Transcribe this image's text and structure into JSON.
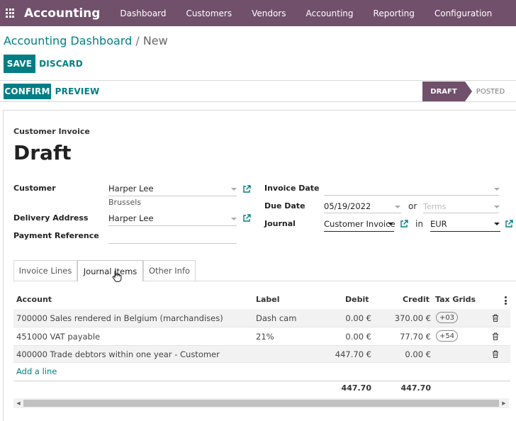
{
  "navbar": {
    "brand": "Accounting",
    "menu": [
      "Dashboard",
      "Customers",
      "Vendors",
      "Accounting",
      "Reporting",
      "Configuration"
    ]
  },
  "breadcrumb": {
    "parent": "Accounting Dashboard",
    "separator": "/",
    "current": "New"
  },
  "buttons": {
    "save": "SAVE",
    "discard": "DISCARD",
    "confirm": "CONFIRM",
    "preview": "PREVIEW"
  },
  "status": {
    "stages": [
      "DRAFT",
      "POSTED"
    ],
    "active": "DRAFT"
  },
  "invoice": {
    "doc_type": "Customer Invoice",
    "title": "Draft",
    "customer_label": "Customer",
    "customer_value": "Harper Lee",
    "customer_city": "Brussels",
    "delivery_label": "Delivery Address",
    "delivery_value": "Harper Lee",
    "payment_ref_label": "Payment Reference",
    "payment_ref_value": "",
    "invoice_date_label": "Invoice Date",
    "invoice_date_value": "",
    "due_date_label": "Due Date",
    "due_date_value": "05/19/2022",
    "or_text": "or",
    "terms_placeholder": "Terms",
    "journal_label": "Journal",
    "journal_value": "Customer Invoice",
    "in_text": "in",
    "currency_value": "EUR"
  },
  "tabs": [
    "Invoice Lines",
    "Journal Items",
    "Other Info"
  ],
  "active_tab": "Journal Items",
  "table": {
    "headers": {
      "account": "Account",
      "label": "Label",
      "debit": "Debit",
      "credit": "Credit",
      "tax_grids": "Tax Grids"
    },
    "rows": [
      {
        "account": "700000 Sales rendered in Belgium (marchandises)",
        "label": "Dash cam",
        "debit": "0.00 €",
        "credit": "370.00 €",
        "tax_grid": "+03"
      },
      {
        "account": "451000 VAT payable",
        "label": "21%",
        "debit": "0.00 €",
        "credit": "77.70 €",
        "tax_grid": "+54"
      },
      {
        "account": "400000 Trade debtors within one year - Customer",
        "label": "",
        "debit": "447.70 €",
        "credit": "0.00 €",
        "tax_grid": ""
      }
    ],
    "add_line": "Add a line",
    "total_debit": "447.70",
    "total_credit": "447.70"
  },
  "colors": {
    "brand": "#71506b",
    "accent": "#017e84"
  }
}
